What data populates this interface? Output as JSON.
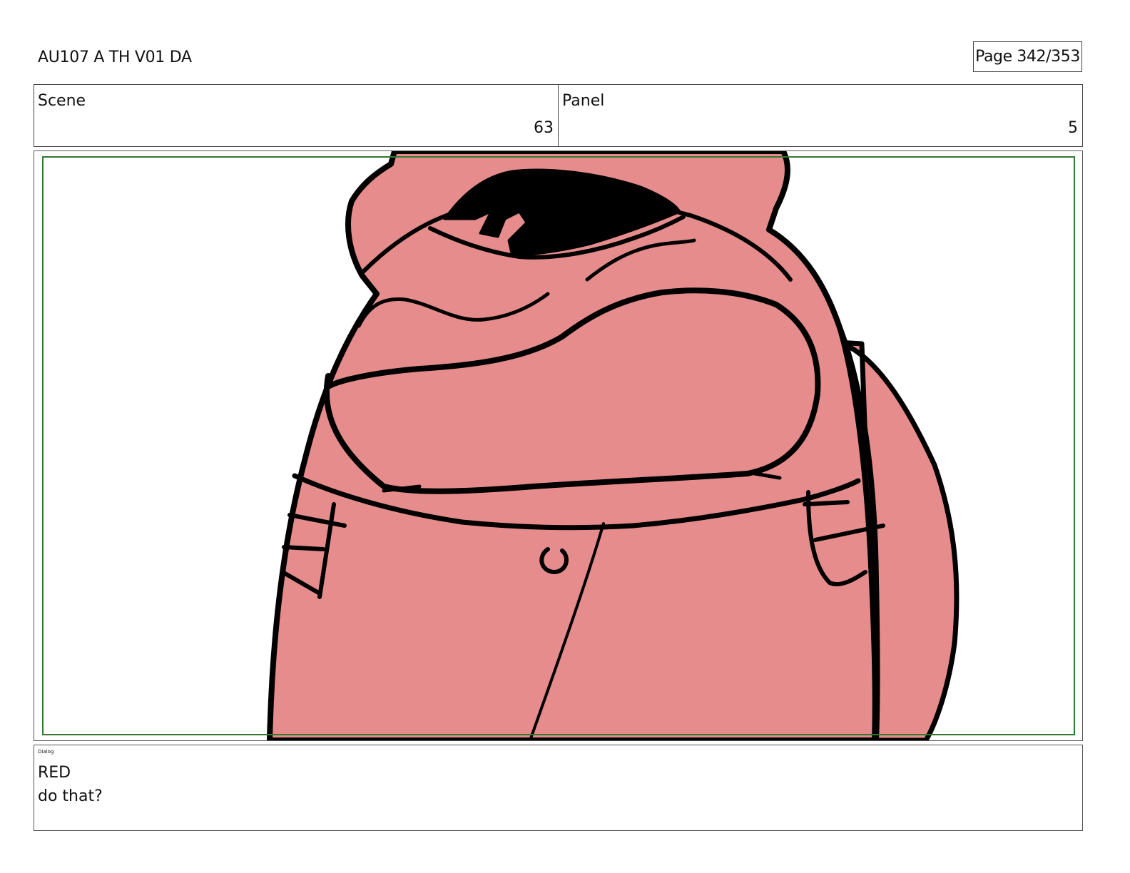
{
  "header": {
    "title": "AU107 A TH V01 DA",
    "page": "Page 342/353"
  },
  "scene": {
    "label": "Scene",
    "value": "63"
  },
  "panel": {
    "label": "Panel",
    "value": "5"
  },
  "artwork": {
    "fill_color": "#e68c8c",
    "line_color": "#000000",
    "safe_area_color": "#2f7a2f"
  },
  "dialog": {
    "label": "Dialog",
    "lines": [
      "RED",
      "do that?"
    ]
  }
}
